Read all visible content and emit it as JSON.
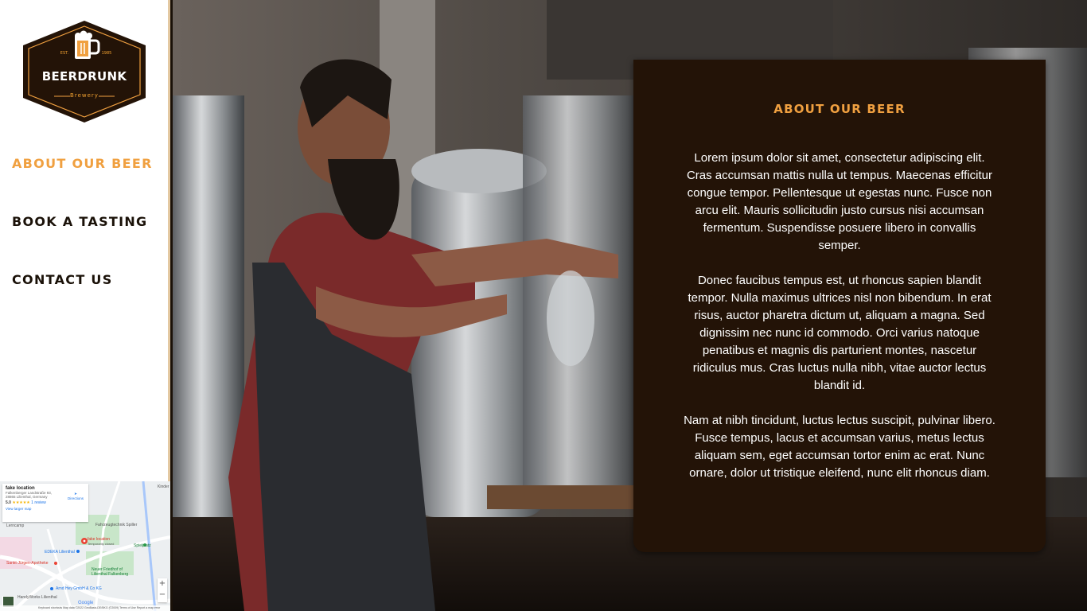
{
  "brand": {
    "name": "BEERDRUNK",
    "subtitle": "Brewery",
    "est_label": "EST.",
    "est_year": "1985",
    "logo_icon": "beer-mug-icon",
    "colors": {
      "dark": "#231307",
      "accent": "#f0a040"
    }
  },
  "nav": {
    "items": [
      {
        "label": "ABOUT OUR BEER",
        "active": true
      },
      {
        "label": "BOOK A TASTING",
        "active": false
      },
      {
        "label": "CONTACT US",
        "active": false
      }
    ]
  },
  "map": {
    "place_name": "fake location",
    "address": "Falkenberger Landstraße 93, 28865 Lilienthal, Germany",
    "rating": "5.0",
    "stars": "★★★★★",
    "reviews": "1 review",
    "view_larger": "View larger map",
    "directions": "Directions",
    "pin_label": "fake location",
    "pin_sublabel": "Temporarily closed",
    "labels": {
      "kinder": "Kinder",
      "fahrzeug": "Fahrzeugtechnik Spiller",
      "edeka": "EDEKA Lilienthal",
      "spielplatz": "Spielplatz",
      "sankt": "Sankt-Jürgen-Apotheke",
      "friedhof": "Neuer Friedhof of Lilienthal Falkenberg",
      "arnd": "Arnd Hey GmbH & Co KG",
      "handy": "HandyWorks Lilienthal",
      "lerncamp": "Lerncamp",
      "google": "Google"
    },
    "footer": "Keyboard shortcuts   Map data ©2022 GeoBasis-DE/BKG (©2009)   Terms of Use   Report a map error"
  },
  "about": {
    "title": "ABOUT OUR BEER",
    "paragraphs": [
      "Lorem ipsum dolor sit amet, consectetur adipiscing elit. Cras accumsan mattis nulla ut tempus. Maecenas efficitur congue tempor. Pellentesque ut egestas nunc. Fusce non arcu elit. Mauris sollicitudin justo cursus nisi accumsan fermentum. Suspendisse posuere libero in convallis semper.",
      "Donec faucibus tempus est, ut rhoncus sapien blandit tempor. Nulla maximus ultrices nisl non bibendum. In erat risus, auctor pharetra dictum ut, aliquam a magna. Sed dignissim nec nunc id commodo. Orci varius natoque penatibus et magnis dis parturient montes, nascetur ridiculus mus. Cras luctus nulla nibh, vitae auctor lectus blandit id.",
      "Nam at nibh tincidunt, luctus lectus suscipit, pulvinar libero. Fusce tempus, lacus et accumsan varius, metus lectus aliquam sem, eget accumsan tortor enim ac erat. Nunc ornare, dolor ut tristique eleifend, nunc elit rhoncus diam."
    ]
  }
}
